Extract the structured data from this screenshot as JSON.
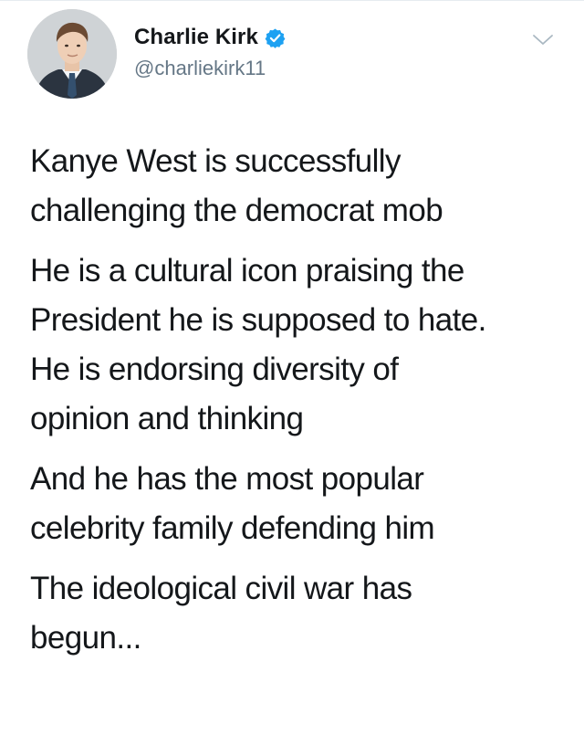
{
  "tweet": {
    "author": {
      "display_name": "Charlie Kirk",
      "handle": "@charliekirk11",
      "verified": true,
      "avatar_icon": "profile-photo",
      "verified_icon": "verified-badge-icon",
      "verified_color": "#1da1f2"
    },
    "menu_icon": "chevron-down-icon",
    "paragraphs": [
      {
        "lines": [
          "Kanye West is successfully",
          "challenging the democrat mob"
        ]
      },
      {
        "lines": [
          "He is a cultural icon praising the",
          "President he is supposed to hate.",
          "He is endorsing diversity of",
          "opinion and thinking"
        ]
      },
      {
        "lines": [
          "And he has the most popular",
          "celebrity family defending him"
        ]
      },
      {
        "lines": [
          "The ideological civil war has",
          "begun..."
        ]
      }
    ]
  },
  "colors": {
    "text_primary": "#14171a",
    "text_secondary": "#657786",
    "accent": "#1da1f2",
    "divider": "#e6ecf0"
  }
}
